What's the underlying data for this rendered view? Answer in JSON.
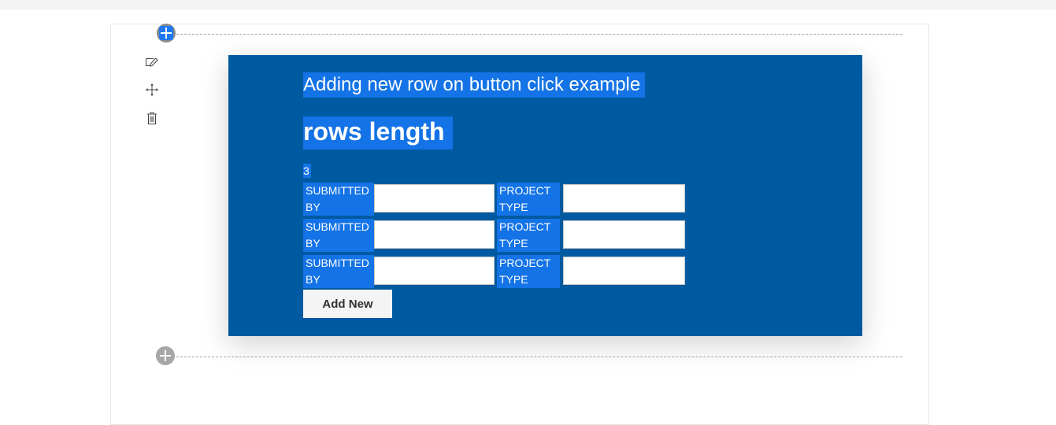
{
  "webpart": {
    "title": "Adding new row on button click example",
    "heading": "rows length",
    "rows_length": "3",
    "rows": [
      {
        "submitted_by_label": "SUBMITTED BY",
        "submitted_by_value": "",
        "project_type_label": "PROJECT TYPE",
        "project_type_value": ""
      },
      {
        "submitted_by_label": "SUBMITTED BY",
        "submitted_by_value": "",
        "project_type_label": "PROJECT TYPE",
        "project_type_value": ""
      },
      {
        "submitted_by_label": "SUBMITTED BY",
        "submitted_by_value": "",
        "project_type_label": "PROJECT TYPE",
        "project_type_value": ""
      }
    ],
    "add_new_label": "Add New"
  },
  "toolbar": {
    "icons": [
      "edit-webpart-icon",
      "move-webpart-icon",
      "delete-webpart-icon"
    ]
  },
  "colors": {
    "webpart_background": "#005aa1",
    "selection_highlight": "#1473e6",
    "add_button_accent": "#1f78f0"
  }
}
